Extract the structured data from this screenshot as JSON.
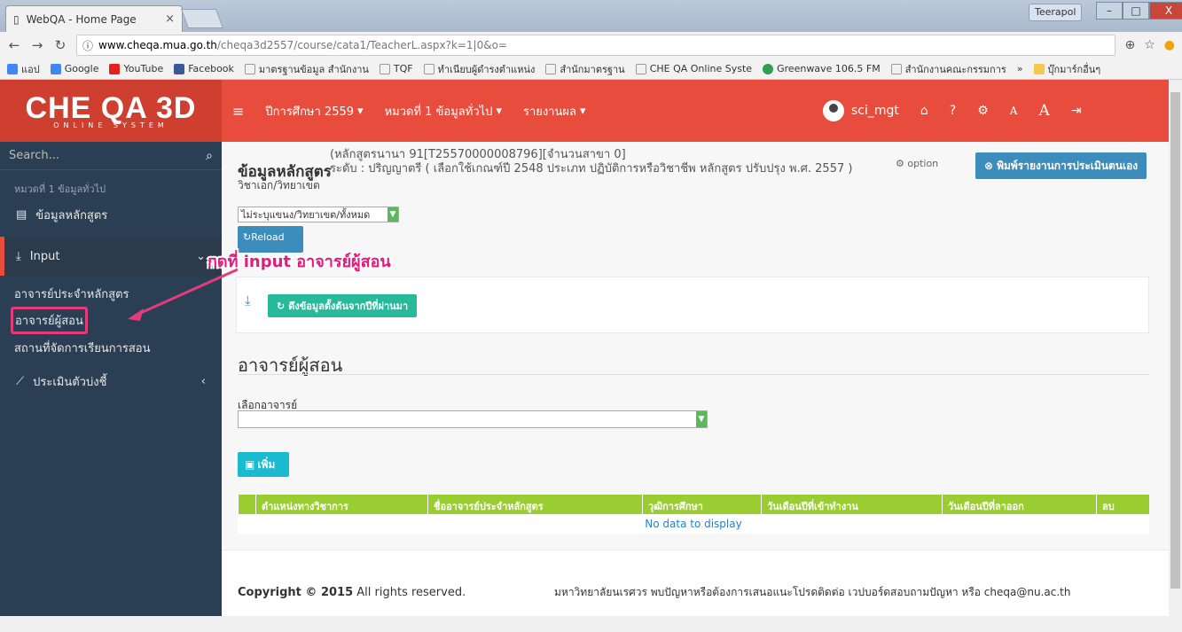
{
  "browser": {
    "tab_title": "WebQA - Home Page",
    "tab_close": "×",
    "user_button": "Teerapol",
    "window_buttons": [
      "–",
      "□",
      "X"
    ],
    "url_domain": "www.cheqa.mua.go.th",
    "url_path": "/cheqa3d2557/course/cata1/TeacherL.aspx?k=1|0&o=",
    "bookmarks": [
      {
        "label": "แอป",
        "icon": "apps-icon",
        "color": "#4285f4"
      },
      {
        "label": "Google",
        "icon": "google-icon",
        "color": "#4285f4"
      },
      {
        "label": "YouTube",
        "icon": "youtube-icon",
        "color": "#e62117"
      },
      {
        "label": "Facebook",
        "icon": "facebook-icon",
        "color": "#3b5998"
      },
      {
        "label": "มาตรฐานข้อมูล สำนักงาน",
        "icon": "page-icon",
        "color": "#999999"
      },
      {
        "label": "TQF",
        "icon": "page-icon",
        "color": "#999999"
      },
      {
        "label": "ทำเนียบผู้ดำรงตำแหน่ง",
        "icon": "page-icon",
        "color": "#999999"
      },
      {
        "label": "สำนักมาตรฐาน",
        "icon": "page-icon",
        "color": "#999999"
      },
      {
        "label": "CHE QA Online Syste",
        "icon": "page-icon",
        "color": "#999999"
      },
      {
        "label": "Greenwave 106.5 FM",
        "icon": "radio-icon",
        "color": "#2e9e4f"
      },
      {
        "label": "สำนักงานคณะกรรมการ",
        "icon": "page-icon",
        "color": "#999999"
      },
      {
        "label": "»",
        "icon": "more-icon",
        "color": "#999999"
      },
      {
        "label": "บุ๊กมาร์กอื่นๆ",
        "icon": "folder-icon",
        "color": "#f2c94c"
      }
    ]
  },
  "app": {
    "logo": "CHE QA 3D",
    "logo_sub": "ONLINE SYSTEM",
    "menu": {
      "year": "ปีการศึกษา 2559",
      "category": "หมวดที่ 1 ข้อมูลทั่วไป",
      "report": "รายงานผล"
    },
    "user": "sci_mgt",
    "font_small": "A",
    "font_large": "A"
  },
  "sidebar": {
    "search_placeholder": "Search...",
    "section_label": "หมวดที่ 1 ข้อมูลทั่วไป",
    "items": [
      {
        "label": "ข้อมูลหลักสูตร"
      },
      {
        "label": "Input"
      },
      {
        "label": "ประเมินตัวบ่งชี้"
      }
    ],
    "sub_items": [
      "อาจารย์ประจำหลักสูตร",
      "อาจารย์ผู้สอน",
      "สถานที่จัดการเรียนการสอน"
    ]
  },
  "page": {
    "title": "ข้อมูลหลักสูตร",
    "meta_line1": "(หลักสูตรนานา 91[T25570000008796][จำนวนสาขา 0]",
    "meta_line2": "ระดับ : ปริญญาตรี ( เลือกใช้เกณฑ์ปี 2548 ประเภท ปฏิบัติการหรือวิชาชีพ หลักสูตร ปรับปรุง พ.ศ. 2557 )",
    "meta_line3": "วิชาเอก/วิทยาเขต",
    "option_label": "option",
    "print_button": "พิมพ์รายงานการประเมินตนเอง",
    "campus_select": "ไม่ระบุแขนง/วิทยาเขต/ทั้งหมด",
    "reload_button": "Reload",
    "annotation": "กดที่ input อาจารย์ผู้สอน",
    "pull_button": "ดึงข้อมูลตั้งต้นจากปีที่ผ่านมา",
    "section_title": "อาจารย์ผู้สอน",
    "select_label": "เลือกอาจารย์",
    "add_button": "เพิ่ม",
    "table_headers": [
      "ตำแหน่งทางวิชาการ",
      "ชื่ออาจารย์ประจำหลักสูตร",
      "วุฒิการศึกษา",
      "วันเดือนปีที่เข้าทำงาน",
      "วันเดือนปีที่ลาออก",
      "ลบ"
    ],
    "no_data": "No data to display"
  },
  "footer": {
    "copyright_bold": "Copyright © 2015",
    "copyright_rest": "All rights reserved.",
    "contact": "มหาวิทยาลัยนเรศวร พบปัญหาหรือต้องการเสนอแนะโปรดติดต่อ เวปบอร์ดสอบถามปัญหา หรือ cheqa@nu.ac.th"
  }
}
